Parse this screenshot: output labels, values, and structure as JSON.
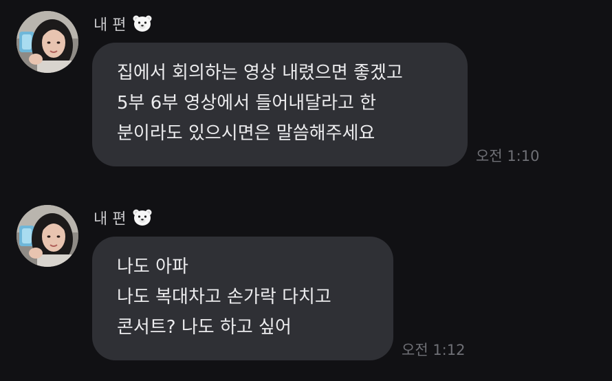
{
  "messages": [
    {
      "sender": "내 편",
      "sender_emoji": "polar-bear-emoji",
      "lines": [
        "집에서 회의하는 영상 내렸으면 좋겠고",
        "5부 6부 영상에서 들어내달라고  한",
        "분이라도 있으시면은 말씀해주세요"
      ],
      "time": "오전 1:10"
    },
    {
      "sender": "내 편",
      "sender_emoji": "polar-bear-emoji",
      "lines": [
        "나도 아파",
        "나도 복대차고 손가락 다치고",
        "콘서트? 나도 하고 싶어"
      ],
      "time": "오전 1:12"
    }
  ],
  "colors": {
    "background": "#111114",
    "bubble": "#2f3035",
    "bubble_text": "#ececee",
    "sender_text": "#c9c9cc",
    "timestamp_text": "#6f7076"
  }
}
